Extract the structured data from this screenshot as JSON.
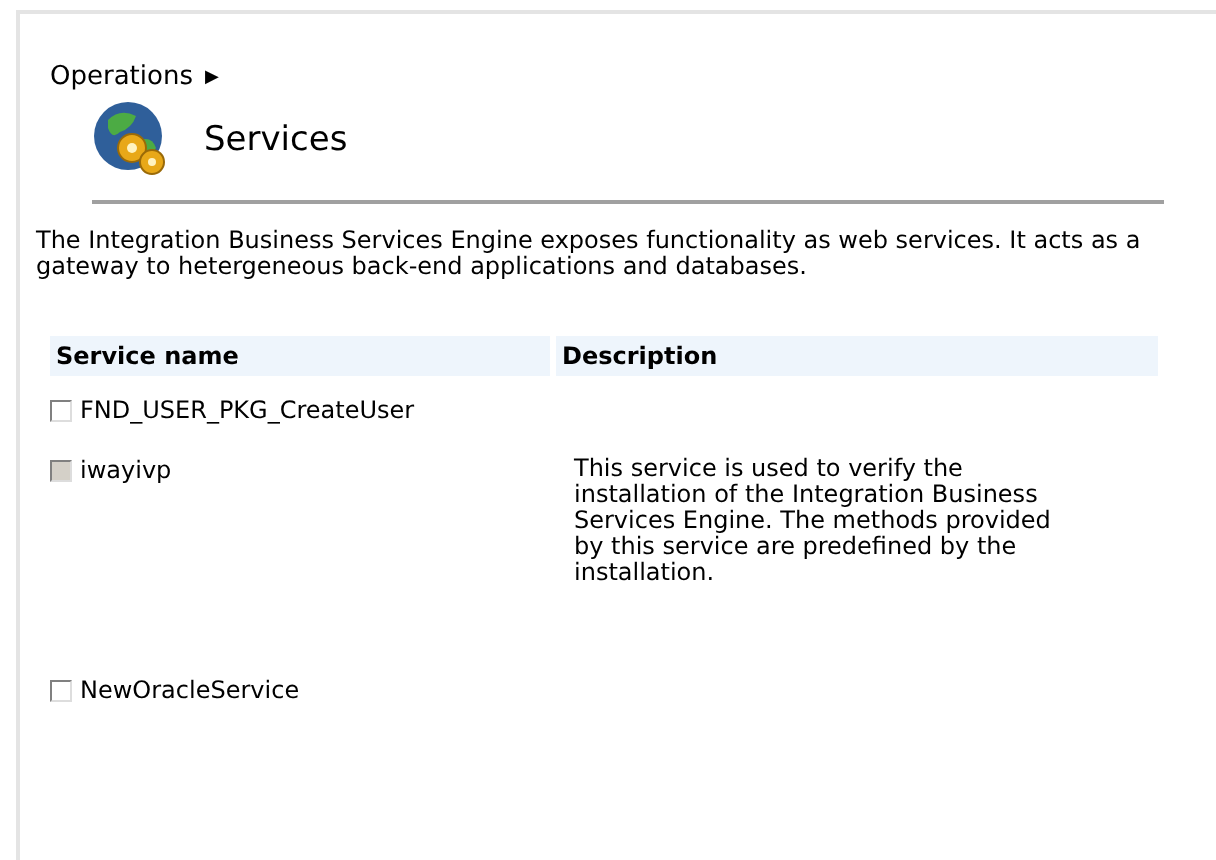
{
  "breadcrumb": {
    "label": "Operations",
    "arrow": "▶"
  },
  "page_title": "Services",
  "intro": "The Integration Business Services Engine exposes functionality as web services. It acts as a gateway to hetergeneous back-end applications and databases.",
  "table": {
    "columns": [
      "Service name",
      "Description"
    ],
    "rows": [
      {
        "name": "FND_USER_PKG_CreateUser",
        "description": "",
        "checked": false,
        "disabled": false
      },
      {
        "name": "iwayivp",
        "description": "This service is used to verify the installation of the Integration Business Services Engine. The methods provided by this service are predefined by the installation.",
        "checked": false,
        "disabled": true
      },
      {
        "name": "NewOracleService",
        "description": "",
        "checked": false,
        "disabled": false
      }
    ]
  }
}
